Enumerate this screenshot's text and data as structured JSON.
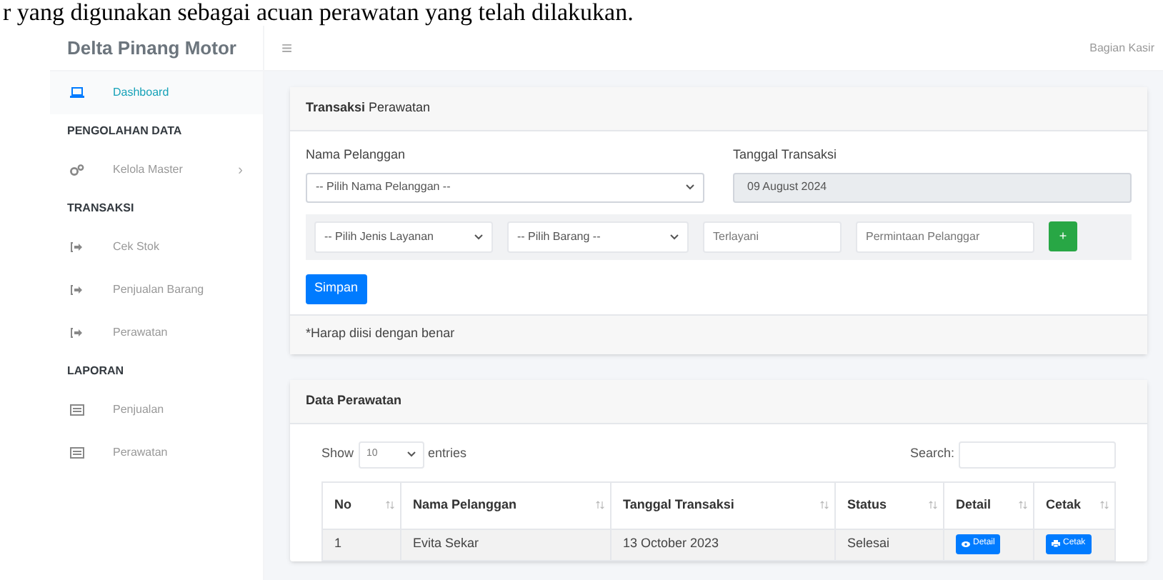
{
  "document_text": "r yang digunakan sebagai acuan perawatan yang telah dilakukan.",
  "brand": "Delta Pinang Motor",
  "menu_icon": "≡",
  "user": "Bagian Kasir",
  "sidebar": [
    {
      "kind": "home",
      "label": "Dashboard",
      "selected": true
    },
    {
      "kind": "header",
      "label": "PENGOLAHAN DATA"
    },
    {
      "kind": "master",
      "label": "Kelola Master",
      "selected": false,
      "chevron": "›"
    },
    {
      "kind": "header",
      "label": "TRANSAKSI"
    },
    {
      "kind": "transaction",
      "label": "Cek Stok",
      "selected": false
    },
    {
      "kind": "transaction",
      "label": "Penjualan Barang",
      "selected": false
    },
    {
      "kind": "transaction",
      "label": "Perawatan",
      "selected": false
    },
    {
      "kind": "header",
      "label": "LAPORAN"
    },
    {
      "kind": "report",
      "label": "Penjualan",
      "selected": false
    },
    {
      "kind": "report",
      "label": "Perawatan",
      "selected": false
    }
  ],
  "form_card": {
    "title_bold": "Transaksi",
    "title_rest": "Perawatan",
    "customer_label": "Nama Pelanggan",
    "customer_select": "-- Pilih Nama Pelanggan --",
    "date_label": "Tanggal Transaksi",
    "date_value": "09 August 2024",
    "service_select": "-- Pilih Jenis Layanan",
    "item_select": "-- Pilih Barang --",
    "served_placeholder": "Terlayani",
    "request_placeholder": "Permintaan Pelanggar",
    "add_button": "+",
    "save_button": "Simpan",
    "footer_note": "*Harap diisi dengan benar"
  },
  "table_card": {
    "title": "Data Perawatan",
    "show_label": "Show",
    "page_size": "10",
    "entries_label": "entries",
    "search_label": "Search:",
    "columns": [
      "No",
      "Nama Pelanggan",
      "Tanggal Transaksi",
      "Status",
      "Detail",
      "Cetak"
    ],
    "rows": [
      {
        "cells": [
          "1",
          "Evita Sekar",
          "13 October 2023",
          "Selesai"
        ],
        "detail": "Detail",
        "print": "Cetak"
      }
    ]
  }
}
